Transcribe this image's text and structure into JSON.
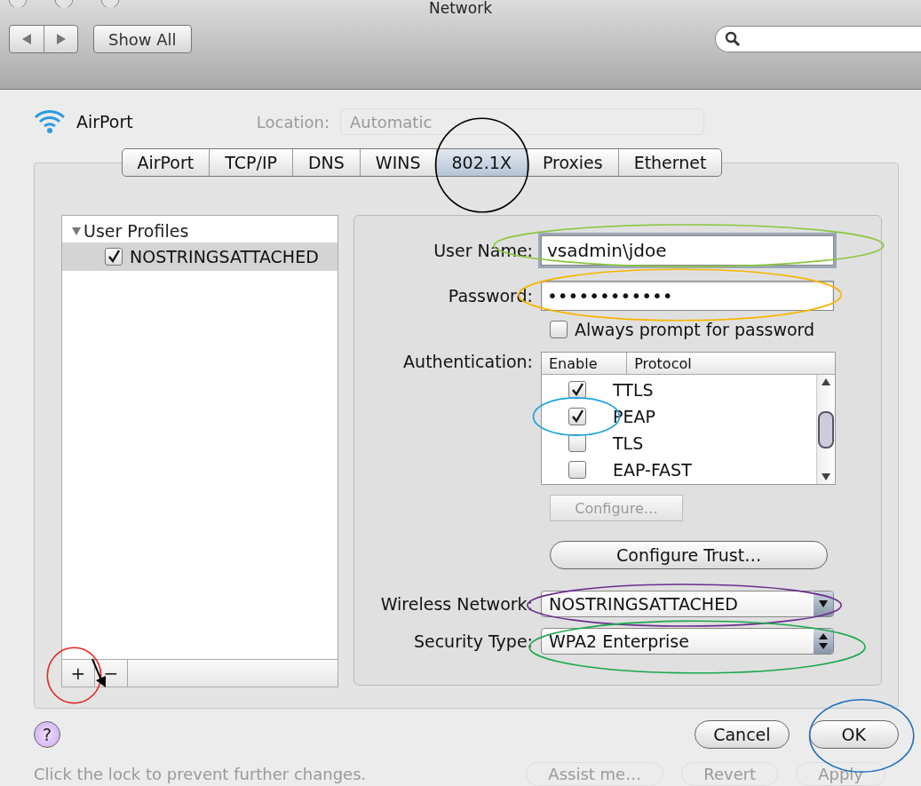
{
  "window": {
    "title": "Network"
  },
  "toolbar": {
    "show_all": "Show All"
  },
  "service": {
    "name": "AirPort"
  },
  "location": {
    "label": "Location:",
    "value": "Automatic"
  },
  "tabs": [
    {
      "label": "AirPort",
      "selected": false
    },
    {
      "label": "TCP/IP",
      "selected": false
    },
    {
      "label": "DNS",
      "selected": false
    },
    {
      "label": "WINS",
      "selected": false
    },
    {
      "label": "802.1X",
      "selected": true,
      "ring": {
        "color": "#000000"
      }
    },
    {
      "label": "Proxies",
      "selected": false
    },
    {
      "label": "Ethernet",
      "selected": false
    }
  ],
  "profiles": {
    "label": "User Profiles",
    "expanded": true,
    "children": [
      {
        "label": "NOSTRINGSATTACHED",
        "checked": true,
        "selected": true
      }
    ]
  },
  "list_buttons": [
    {
      "label": "+",
      "ring": {
        "color": "#e8231f"
      }
    },
    {
      "label": "−",
      "arrow": true
    }
  ],
  "form": {
    "user_name": {
      "label": "User Name:",
      "value": "vsadmin\\jdoe",
      "ring": {
        "color": "#8cc63f"
      }
    },
    "password": {
      "label": "Password:",
      "value": "••••••••••••",
      "ring": {
        "color": "#f7b500"
      }
    },
    "always_prompt": {
      "label": "Always prompt for password",
      "checked": false
    },
    "authentication": {
      "label": "Authentication:",
      "columns": [
        "Enable",
        "Protocol"
      ],
      "rows": [
        {
          "protocol": "TTLS",
          "checked": true
        },
        {
          "protocol": "PEAP",
          "checked": true,
          "ring": {
            "color": "#1ba3dc"
          }
        },
        {
          "protocol": "TLS",
          "checked": false
        },
        {
          "protocol": "EAP-FAST",
          "checked": false
        }
      ]
    },
    "configure": {
      "label": "Configure…",
      "disabled": true
    },
    "configure_trust": {
      "label": "Configure Trust…",
      "disabled": false
    },
    "wireless_network": {
      "label": "Wireless Network:",
      "value": "NOSTRINGSATTACHED",
      "ring": {
        "color": "#6b2d8f"
      }
    },
    "security_type": {
      "label": "Security Type:",
      "value": "WPA2 Enterprise",
      "ring": {
        "color": "#1aa84a"
      }
    }
  },
  "help": {
    "label": "?"
  },
  "buttons": [
    {
      "label": "Cancel"
    },
    {
      "label": "OK",
      "ring": {
        "color": "#1e6ebf"
      }
    }
  ],
  "footer": {
    "lock_text": "Click the lock to prevent further changes.",
    "buttons": [
      "Assist me…",
      "Revert",
      "Apply"
    ]
  }
}
